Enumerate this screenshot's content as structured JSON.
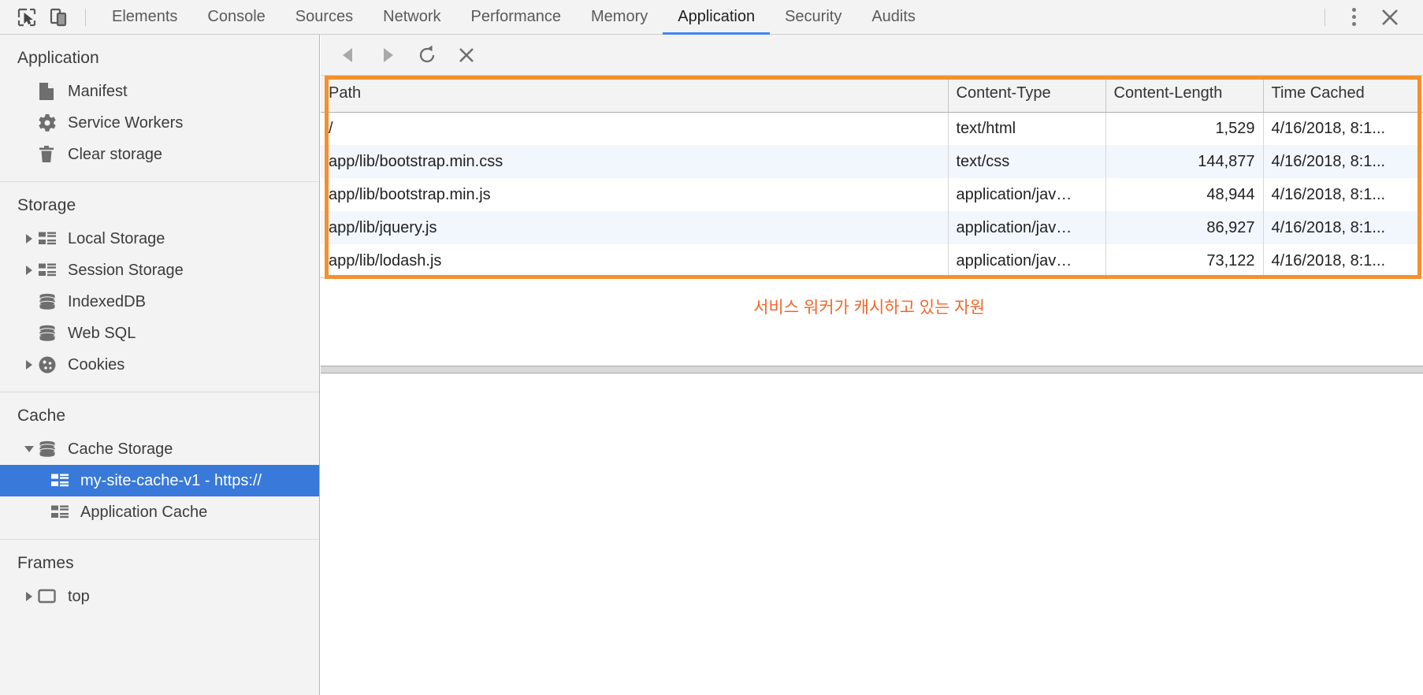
{
  "window": {
    "tabs": [
      {
        "label": "Elements",
        "active": false
      },
      {
        "label": "Console",
        "active": false
      },
      {
        "label": "Sources",
        "active": false
      },
      {
        "label": "Network",
        "active": false
      },
      {
        "label": "Performance",
        "active": false
      },
      {
        "label": "Memory",
        "active": false
      },
      {
        "label": "Application",
        "active": true
      },
      {
        "label": "Security",
        "active": false
      },
      {
        "label": "Audits",
        "active": false
      }
    ],
    "left_icons": [
      "inspect-element-icon",
      "device-toolbar-icon"
    ],
    "right_icons": [
      "more-options-icon",
      "close-icon"
    ],
    "accent_color": "#4285f4"
  },
  "sidebar": {
    "sections": [
      {
        "title": "Application",
        "items": [
          {
            "label": "Manifest",
            "icon": "manifest-document-icon",
            "triangle": "none",
            "selected": false
          },
          {
            "label": "Service Workers",
            "icon": "gear-icon",
            "triangle": "none",
            "selected": false
          },
          {
            "label": "Clear storage",
            "icon": "trash-icon",
            "triangle": "none",
            "selected": false
          }
        ]
      },
      {
        "title": "Storage",
        "items": [
          {
            "label": "Local Storage",
            "icon": "table-grid-icon",
            "triangle": "collapsed",
            "selected": false
          },
          {
            "label": "Session Storage",
            "icon": "table-grid-icon",
            "triangle": "collapsed",
            "selected": false
          },
          {
            "label": "IndexedDB",
            "icon": "database-icon",
            "triangle": "none",
            "selected": false
          },
          {
            "label": "Web SQL",
            "icon": "database-icon",
            "triangle": "none",
            "selected": false
          },
          {
            "label": "Cookies",
            "icon": "cookie-icon",
            "triangle": "collapsed",
            "selected": false
          }
        ]
      },
      {
        "title": "Cache",
        "items": [
          {
            "label": "Cache Storage",
            "icon": "database-icon",
            "triangle": "expanded",
            "selected": false
          },
          {
            "label": "my-site-cache-v1 - https://",
            "icon": "table-grid-icon",
            "triangle": "none",
            "selected": true,
            "indent": true
          },
          {
            "label": "Application Cache",
            "icon": "table-grid-icon",
            "triangle": "none",
            "selected": false,
            "indent": true
          }
        ]
      },
      {
        "title": "Frames",
        "items": [
          {
            "label": "top",
            "icon": "frame-icon",
            "triangle": "collapsed",
            "selected": false
          }
        ]
      }
    ],
    "selection_color": "#3879d9"
  },
  "main": {
    "toolbar_buttons": [
      {
        "name": "back-button",
        "icon": "triangle-left-icon"
      },
      {
        "name": "forward-button",
        "icon": "triangle-right-icon"
      },
      {
        "name": "refresh-button",
        "icon": "refresh-icon"
      },
      {
        "name": "delete-button",
        "icon": "cross-icon"
      }
    ],
    "table": {
      "columns": [
        "Path",
        "Content-Type",
        "Content-Length",
        "Time Cached"
      ],
      "rows": [
        {
          "path": "/",
          "type": "text/html",
          "length": "1,529",
          "time": "4/16/2018, 8:1..."
        },
        {
          "path": "app/lib/bootstrap.min.css",
          "type": "text/css",
          "length": "144,877",
          "time": "4/16/2018, 8:1..."
        },
        {
          "path": "app/lib/bootstrap.min.js",
          "type": "application/jav…",
          "length": "48,944",
          "time": "4/16/2018, 8:1..."
        },
        {
          "path": "app/lib/jquery.js",
          "type": "application/jav…",
          "length": "86,927",
          "time": "4/16/2018, 8:1..."
        },
        {
          "path": "app/lib/lodash.js",
          "type": "application/jav…",
          "length": "73,122",
          "time": "4/16/2018, 8:1..."
        }
      ]
    },
    "annotation": {
      "caption": "서비스 워커가 캐시하고 있는 자원",
      "box_color": "#f5902b",
      "caption_color": "#f2672b"
    }
  }
}
